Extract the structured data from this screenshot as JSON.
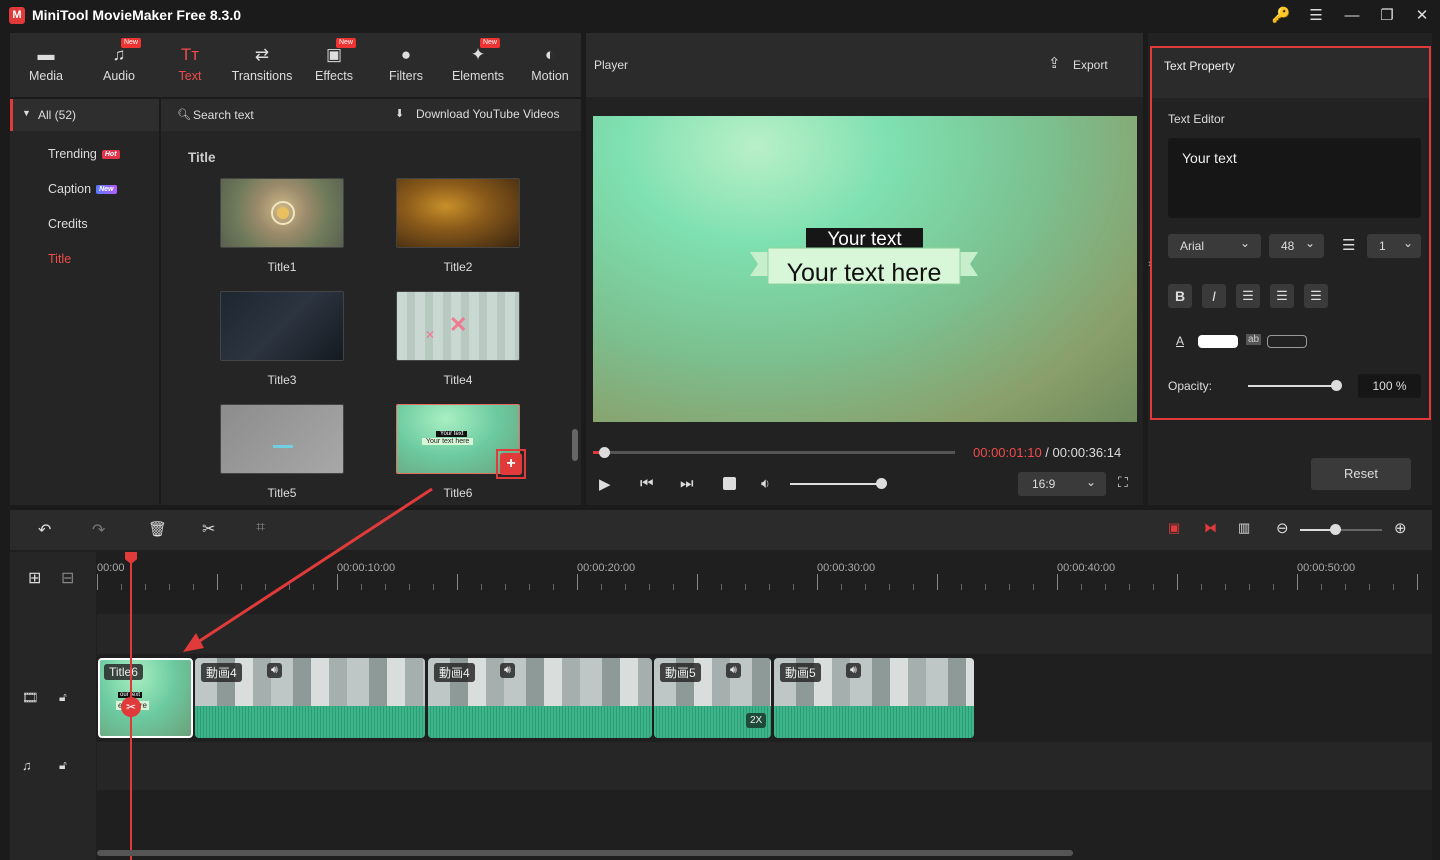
{
  "app": {
    "title": "MiniTool MovieMaker Free 8.3.0",
    "logo": "M"
  },
  "window": {
    "key_icon": "🔑",
    "menu_icon": "☰",
    "min_icon": "—",
    "max_icon": "❐",
    "close_icon": "✕"
  },
  "toolbar": {
    "items": [
      {
        "label": "Media",
        "icon": "folder-icon",
        "glyph": "▬",
        "new": ""
      },
      {
        "label": "Audio",
        "icon": "music-note-icon",
        "glyph": "♫",
        "new": "New"
      },
      {
        "label": "Text",
        "icon": "text-icon",
        "glyph": "Tт",
        "new": ""
      },
      {
        "label": "Transitions",
        "icon": "transition-icon",
        "glyph": "⇄",
        "new": ""
      },
      {
        "label": "Effects",
        "icon": "effects-icon",
        "glyph": "▣",
        "new": "New"
      },
      {
        "label": "Filters",
        "icon": "filters-icon",
        "glyph": "●",
        "new": ""
      },
      {
        "label": "Elements",
        "icon": "elements-icon",
        "glyph": "✦",
        "new": "New"
      },
      {
        "label": "Motion",
        "icon": "motion-icon",
        "glyph": "◐",
        "new": ""
      }
    ]
  },
  "categories": {
    "all": "All (52)",
    "items": [
      {
        "label": "Trending",
        "badge": "Hot"
      },
      {
        "label": "Caption",
        "badge": "New"
      },
      {
        "label": "Credits",
        "badge": ""
      },
      {
        "label": "Title",
        "badge": ""
      }
    ]
  },
  "library": {
    "search_placeholder": "Search text",
    "download_label": "Download YouTube Videos",
    "section_title": "Title",
    "items": [
      "Title1",
      "Title2",
      "Title3",
      "Title4",
      "Title5",
      "Title6"
    ],
    "thumb_text_top": "Your text",
    "thumb_text_bottom": "Your text here"
  },
  "player": {
    "title": "Player",
    "export_label": "Export",
    "overlay_top": "Your text",
    "overlay_bottom": "Your text here",
    "current_time": "00:00:01:10",
    "separator": " / ",
    "total_time": "00:00:36:14",
    "aspect": "16:9",
    "progress": 0.03,
    "volume": 0.97
  },
  "properties": {
    "title": "Text Property",
    "editor_label": "Text Editor",
    "editor_value": "Your text",
    "font": "Arial",
    "size": "48",
    "line_spacing": "1",
    "bold": "B",
    "italic": "I",
    "color_label": "A",
    "bg_label": "ab",
    "opacity_label": "Opacity:",
    "opacity_value": "100 %",
    "opacity_level": 1.0,
    "reset_label": "Reset",
    "accent_color": "#e03a3a"
  },
  "timeline": {
    "ruler_labels": [
      "00:00",
      "00:00:10:00",
      "00:00:20:00",
      "00:00:30:00",
      "00:00:40:00",
      "00:00:50:00"
    ],
    "text_clip": "Title6",
    "text_clip_line1": "our text",
    "text_clip_line2": "ext here",
    "clips": [
      {
        "name": "動画4"
      },
      {
        "name": "動画4"
      },
      {
        "name": "動画5",
        "speed": "2X"
      },
      {
        "name": "動画5"
      }
    ]
  }
}
